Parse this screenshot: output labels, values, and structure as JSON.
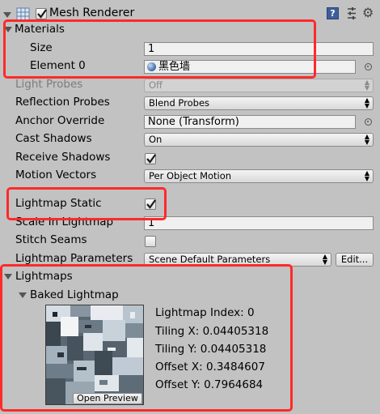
{
  "component": {
    "title": "Mesh Renderer"
  },
  "materials": {
    "header": "Materials",
    "size_label": "Size",
    "size_value": "1",
    "element_label": "Element 0",
    "element_value": "黑色墙"
  },
  "rows": {
    "light_probes": {
      "label": "Light Probes",
      "value": "Off"
    },
    "reflection_probes": {
      "label": "Reflection Probes",
      "value": "Blend Probes"
    },
    "anchor_override": {
      "label": "Anchor Override",
      "value": "None (Transform)"
    },
    "cast_shadows": {
      "label": "Cast Shadows",
      "value": "On"
    },
    "receive_shadows": {
      "label": "Receive Shadows",
      "checked": true
    },
    "motion_vectors": {
      "label": "Motion Vectors",
      "value": "Per Object Motion"
    },
    "lightmap_static": {
      "label": "Lightmap Static",
      "checked": true
    },
    "scale_in_lightmap": {
      "label": "Scale In Lightmap",
      "value": "1"
    },
    "stitch_seams": {
      "label": "Stitch Seams",
      "checked": false
    },
    "lightmap_parameters": {
      "label": "Lightmap Parameters",
      "value": "Scene Default Parameters",
      "edit_label": "Edit..."
    }
  },
  "lightmaps": {
    "header": "Lightmaps",
    "baked_header": "Baked Lightmap",
    "open_preview_label": "Open Preview",
    "index_line": "Lightmap Index: 0",
    "tiling_x_line": "Tiling X: 0.04405318",
    "tiling_y_line": "Tiling Y: 0.04405318",
    "offset_x_line": "Offset X: 0.3484607",
    "offset_y_line": "Offset Y: 0.7964684"
  },
  "colors": {
    "annotation_red": "#ff2a2a",
    "panel_bg": "#c2c2c2",
    "checkmark": "#1a1a1a"
  }
}
